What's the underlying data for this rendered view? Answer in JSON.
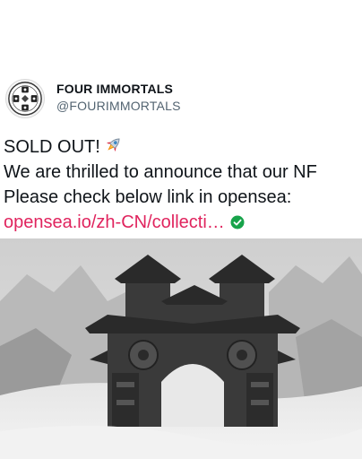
{
  "tweet": {
    "author": {
      "display_name": "FOUR IMMORTALS",
      "handle": "@FOURIMMORTALS",
      "avatar_icon": "four-immortals-logo-icon"
    },
    "lines": [
      "SOLD OUT!",
      "We are thrilled to announce that our NF",
      "Please check below link in opensea:"
    ],
    "link_text": "opensea.io/zh-CN/collecti…",
    "rocket_icon": "rocket-emoji-icon",
    "verified_icon": "verified-check-icon",
    "link_color": "#e0245e",
    "verified_color": "#17a34a",
    "media": {
      "image_icon": "ancient-chinese-gate-image"
    }
  }
}
